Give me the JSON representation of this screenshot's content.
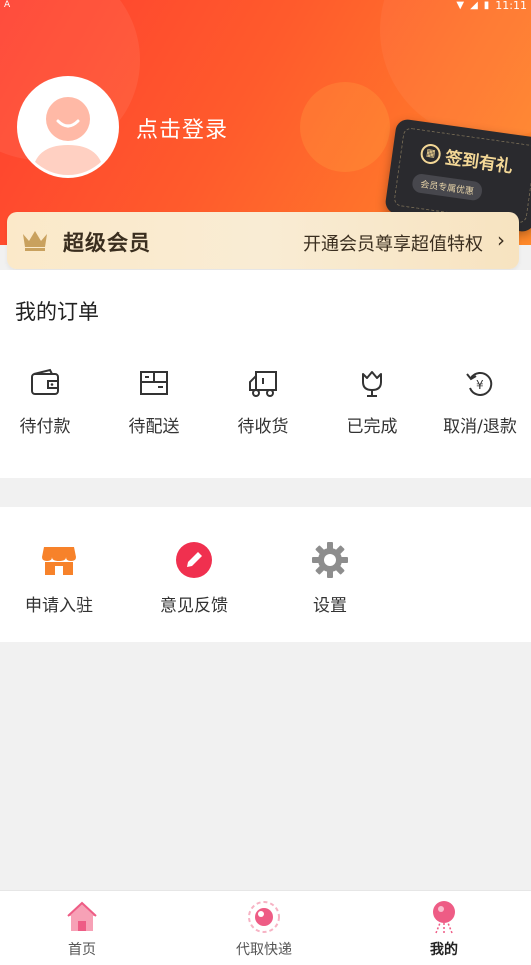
{
  "status_bar": {
    "left_indicator": "A",
    "time": "11:11"
  },
  "profile": {
    "login_text": "点击登录"
  },
  "signin_card": {
    "title": "签到有礼",
    "subtitle": "会员专属优惠"
  },
  "vip": {
    "title": "超级会员",
    "promo": "开通会员尊享超值特权",
    "chevron": "›"
  },
  "orders": {
    "title": "我的订单",
    "items": [
      {
        "label": "待付款",
        "icon": "wallet-icon"
      },
      {
        "label": "待配送",
        "icon": "package-icon"
      },
      {
        "label": "待收货",
        "icon": "truck-icon"
      },
      {
        "label": "已完成",
        "icon": "tulip-icon"
      },
      {
        "label": "取消/退款",
        "icon": "refund-icon"
      }
    ]
  },
  "tools": {
    "items": [
      {
        "label": "申请入驻",
        "icon": "store-icon"
      },
      {
        "label": "意见反馈",
        "icon": "pencil-icon"
      },
      {
        "label": "设置",
        "icon": "gear-icon"
      }
    ]
  },
  "bottom_nav": {
    "items": [
      {
        "label": "首页",
        "icon": "home-icon"
      },
      {
        "label": "代取快递",
        "icon": "delivery-icon"
      },
      {
        "label": "我的",
        "icon": "profile-icon",
        "active": true
      }
    ]
  },
  "colors": {
    "header_start": "#ff3f2f",
    "header_end": "#ff8a2a",
    "vip_text": "#3a2e1f",
    "gold": "#f3d796",
    "accent_pink": "#f0304f",
    "store_orange": "#f7822a"
  }
}
